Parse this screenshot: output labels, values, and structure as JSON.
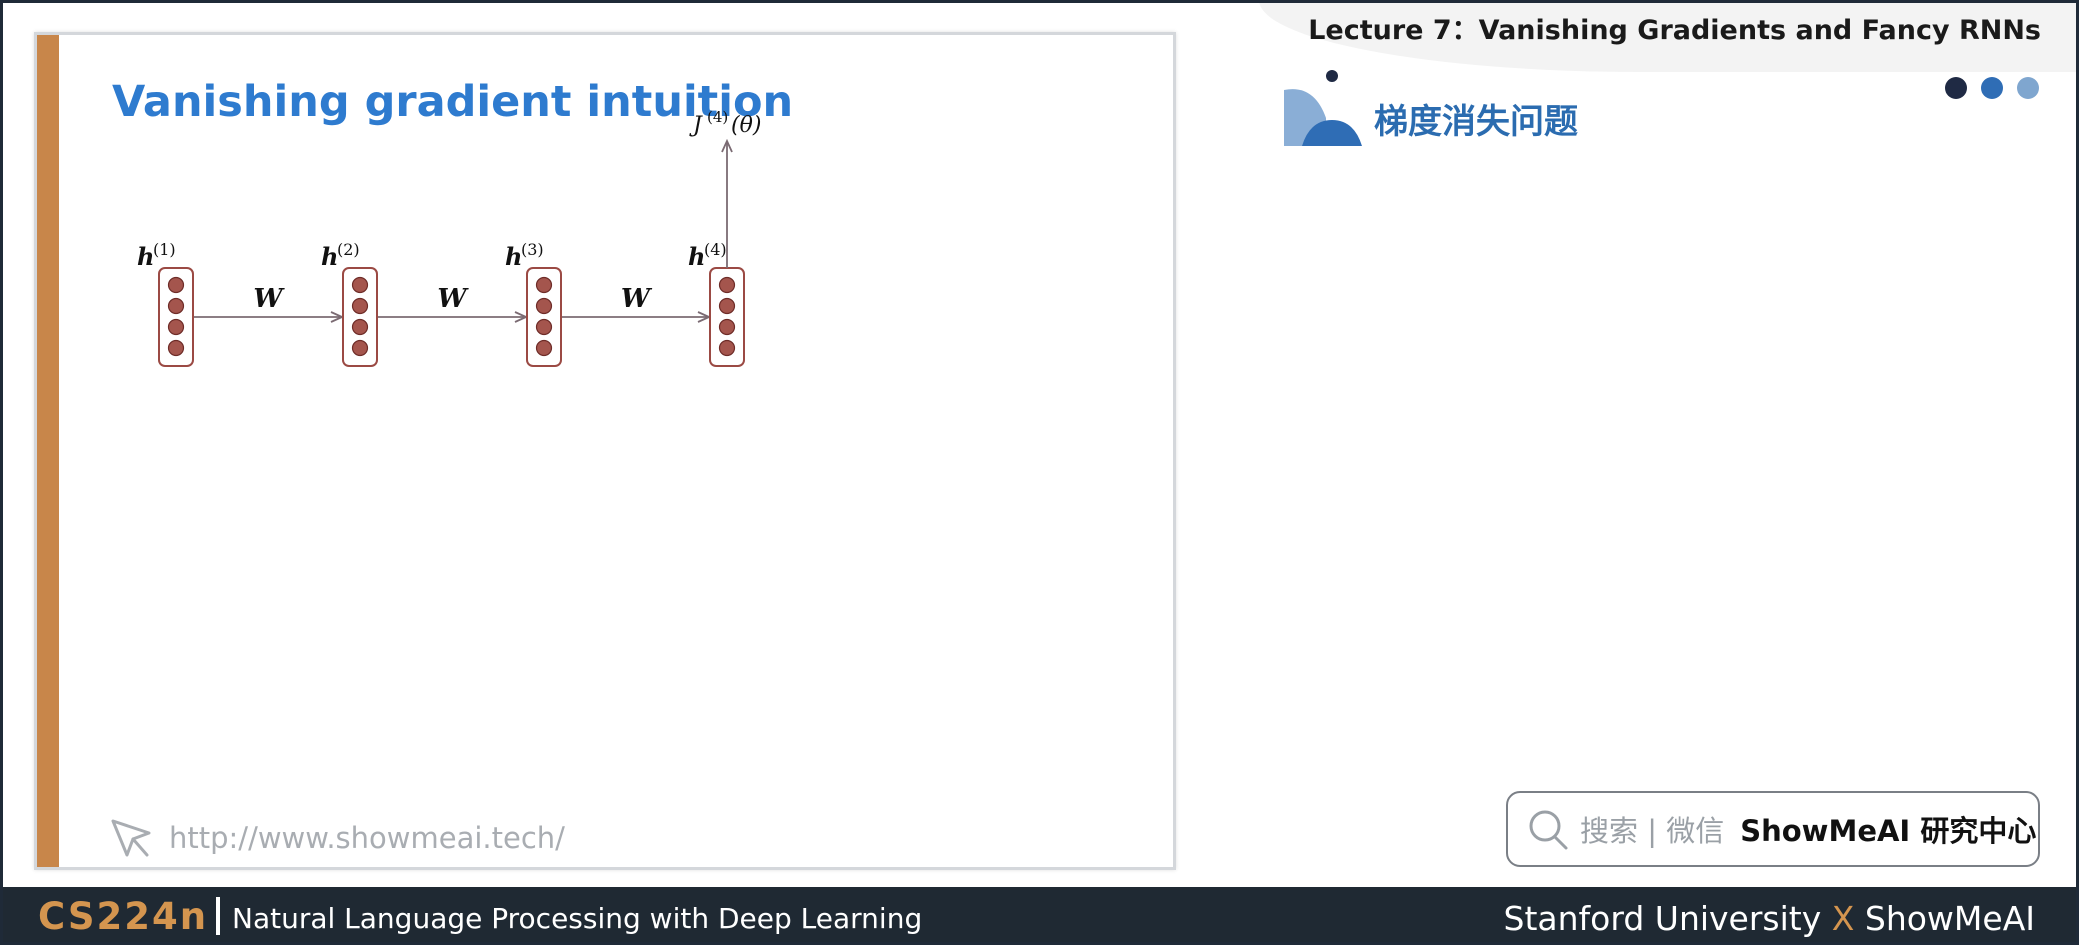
{
  "header": {
    "lecture_title": "Lecture 7：Vanishing Gradients and Fancy RNNs",
    "section_title": "梯度消失问题",
    "nav_dots": [
      "#1f2a44",
      "#2f6db5",
      "#7fa6cf"
    ]
  },
  "slide": {
    "title": "Vanishing gradient intuition",
    "watermark_url": "http://www.showmeai.tech/"
  },
  "diagram": {
    "hidden_states": [
      {
        "symbol": "h",
        "superscript": "(1)"
      },
      {
        "symbol": "h",
        "superscript": "(2)"
      },
      {
        "symbol": "h",
        "superscript": "(3)"
      },
      {
        "symbol": "h",
        "superscript": "(4)"
      }
    ],
    "weight_labels": [
      "W",
      "W",
      "W"
    ],
    "loss": {
      "symbol": "J",
      "superscript": "(4)",
      "argument": "(θ)"
    },
    "colors": {
      "node_fill": "#a4554d",
      "box_stroke": "#9b4a44",
      "arrow": "#7b6b73"
    }
  },
  "search_widget": {
    "hint": "搜索 | 微信",
    "brand": "ShowMeAI 研究中心"
  },
  "footer": {
    "course": "CS224n",
    "subtitle": "Natural Language Processing with Deep Learning",
    "right_left": "Stanford University",
    "right_x": "X",
    "right_right": "ShowMeAI"
  },
  "colors": {
    "accent_bar": "#c8864a",
    "title_blue": "#2e7bcf",
    "footer_bg": "#1f2933",
    "footer_orange": "#d4954f"
  }
}
